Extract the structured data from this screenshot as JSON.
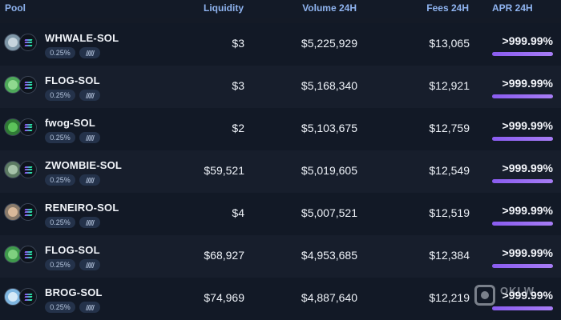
{
  "header": {
    "pool": "Pool",
    "liquidity": "Liquidity",
    "volume": "Volume 24H",
    "fees": "Fees 24H",
    "apr": "APR 24H"
  },
  "rows": [
    {
      "name": "WHWALE-SOL",
      "fee": "0.25%",
      "liquidity": "$3",
      "volume": "$5,225,929",
      "fees": "$13,065",
      "apr": "&gt;999.99%",
      "token_color": "#7f97a8",
      "token_icon": "whale-face-icon"
    },
    {
      "name": "FLOG-SOL",
      "fee": "0.25%",
      "liquidity": "$3",
      "volume": "$5,168,340",
      "fees": "$12,921",
      "apr": "&gt;999.99%",
      "token_color": "#4ea95a",
      "token_icon": "frog-face-icon"
    },
    {
      "name": "fwog-SOL",
      "fee": "0.25%",
      "liquidity": "$2",
      "volume": "$5,103,675",
      "fees": "$12,759",
      "apr": "&gt;999.99%",
      "token_color": "#2f7a35",
      "token_icon": "frog-face-icon"
    },
    {
      "name": "ZWOMBIE-SOL",
      "fee": "0.25%",
      "liquidity": "$59,521",
      "volume": "$5,019,605",
      "fees": "$12,549",
      "apr": "&gt;999.99%",
      "token_color": "#5c7a63",
      "token_icon": "zombie-face-icon"
    },
    {
      "name": "RENEIRO-SOL",
      "fee": "0.25%",
      "liquidity": "$4",
      "volume": "$5,007,521",
      "fees": "$12,519",
      "apr": "&gt;999.99%",
      "token_color": "#8a7b6b",
      "token_icon": "person-face-icon"
    },
    {
      "name": "FLOG-SOL",
      "fee": "0.25%",
      "liquidity": "$68,927",
      "volume": "$4,953,685",
      "fees": "$12,384",
      "apr": "&gt;999.99%",
      "token_color": "#3f9a4c",
      "token_icon": "frog-face-icon"
    },
    {
      "name": "BROG-SOL",
      "fee": "0.25%",
      "liquidity": "$74,969",
      "volume": "$4,887,640",
      "fees": "$12,219",
      "apr": "&gt;999.99%",
      "token_color": "#7fb6e0",
      "token_icon": "frog-face-icon"
    }
  ],
  "colors": {
    "accent_bar": "#8a5cf0",
    "header_text": "#8fb4f0",
    "badge_bg": "#24324a"
  },
  "watermark": {
    "text": "OKLW"
  }
}
